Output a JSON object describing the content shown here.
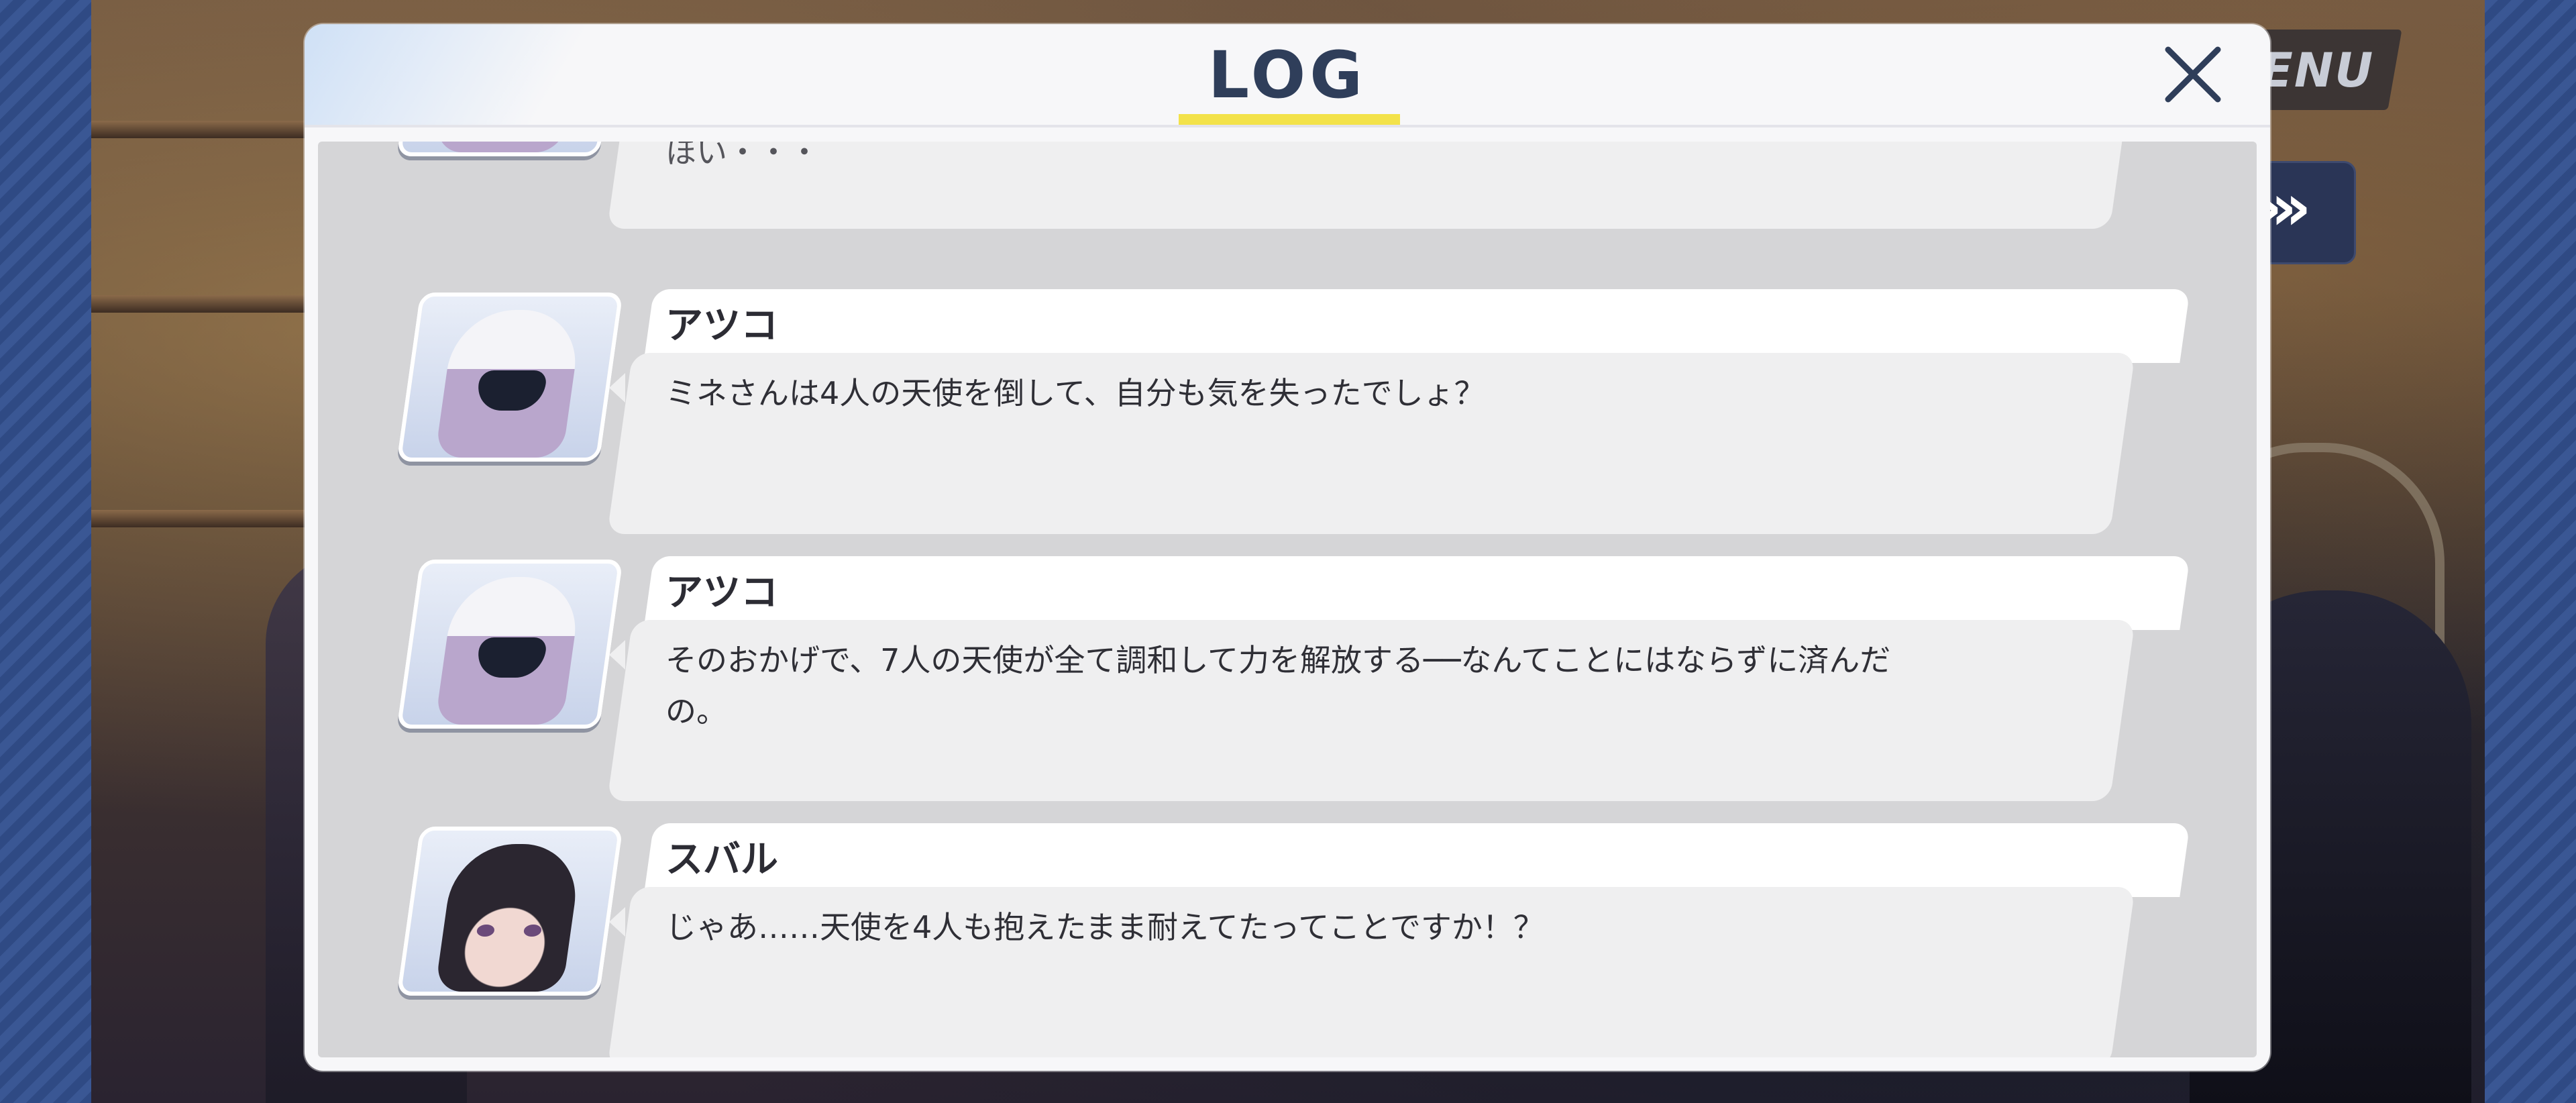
{
  "header": {
    "title": "LOG",
    "menu_label": "ENU",
    "skip_label": "»",
    "close_icon": "close-icon"
  },
  "colors": {
    "accent_underline": "#f3e24a",
    "title": "#2f3e5a",
    "modal_bg": "#f7f7f9",
    "log_area_bg": "#d5d5d7"
  },
  "entries": [
    {
      "speaker": "",
      "avatar": "hooded-girl-avatar",
      "text": "ほい・・・",
      "partial": true
    },
    {
      "speaker": "アツコ",
      "avatar": "hooded-girl-avatar",
      "text": "ミネさんは4人の天使を倒して、自分も気を失ったでしょ？"
    },
    {
      "speaker": "アツコ",
      "avatar": "hooded-girl-avatar",
      "text": "そのおかげで、7人の天使が全て調和して力を解放する──なんてことにはならずに済んだ\nの。"
    },
    {
      "speaker": "スバル",
      "avatar": "dark-hair-girl-avatar",
      "text": "じゃあ……天使を4人も抱えたまま耐えてたってことですか！？"
    }
  ]
}
